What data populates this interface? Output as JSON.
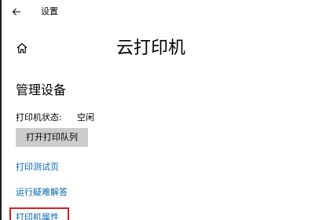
{
  "titlebar": {
    "back_icon": "arrow-left-icon",
    "title": "设置"
  },
  "header": {
    "home_icon": "home-icon",
    "page_title": "云打印机"
  },
  "section": {
    "heading": "管理设备",
    "status_label": "打印机状态:",
    "status_value": "空闲",
    "open_queue_label": "打开打印队列"
  },
  "links": {
    "print_test_page": "打印测试页",
    "run_troubleshooter": "运行疑难解答",
    "printer_properties": "打印机属性"
  },
  "colors": {
    "link": "#0066b4",
    "button_bg": "#cccccc",
    "highlight_box": "#d32020"
  }
}
